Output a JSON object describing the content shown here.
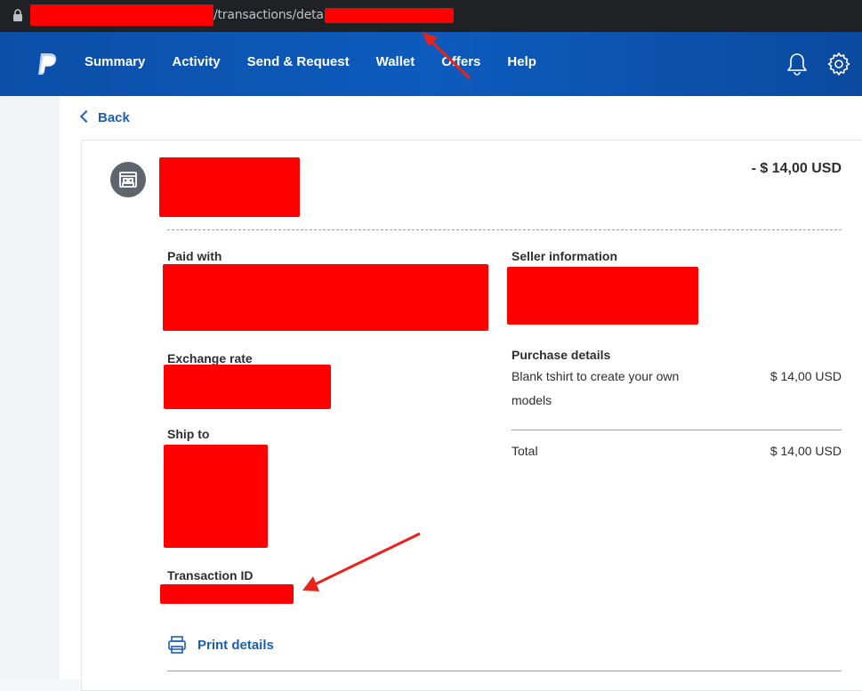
{
  "browser": {
    "url_path": "/transactions/details/"
  },
  "nav": {
    "items": [
      "Summary",
      "Activity",
      "Send & Request",
      "Wallet",
      "Offers",
      "Help"
    ],
    "icons": {
      "logo": "paypal-logo",
      "notifications": "bell-icon",
      "settings": "gear-icon"
    }
  },
  "back_label": "Back",
  "transaction": {
    "amount": "- $ 14,00 USD",
    "paid_with_label": "Paid with",
    "exchange_rate_label": "Exchange rate",
    "ship_to_label": "Ship to",
    "transaction_id_label": "Transaction ID",
    "seller_info_label": "Seller information",
    "purchase_details_label": "Purchase details",
    "item_description": "Blank tshirt to create your own models",
    "item_amount": "$ 14,00 USD",
    "total_label": "Total",
    "total_amount": "$ 14,00 USD"
  },
  "print_label": "Print details",
  "colors": {
    "brand_blue": "#0d5bbd",
    "link_blue": "#1a5fb4",
    "redaction": "#ff0000",
    "annotation_arrow": "#e8231a"
  }
}
